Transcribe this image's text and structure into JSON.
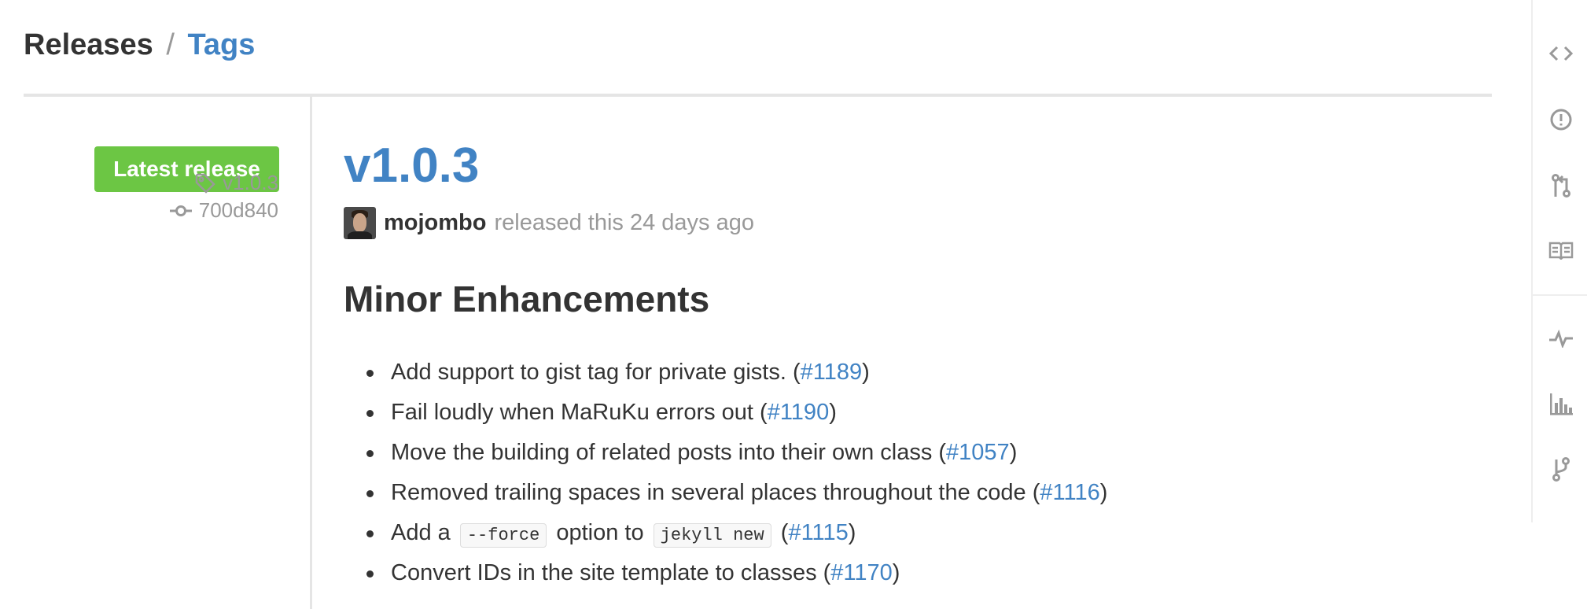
{
  "header": {
    "releases_label": "Releases",
    "separator": "/",
    "tags_label": "Tags"
  },
  "sidebar": {
    "latest_release_label": "Latest release",
    "tag_name": "v1.0.3",
    "commit_sha": "700d840",
    "latest_color": "#6cc644"
  },
  "release": {
    "version": "v1.0.3",
    "author": "mojombo",
    "released_text": "released this 24 days ago",
    "section_title": "Minor Enhancements",
    "notes": [
      {
        "before": "Add support to gist tag for private gists. (",
        "link": "#1189",
        "after": ")"
      },
      {
        "before": "Fail loudly when MaRuKu errors out (",
        "link": "#1190",
        "after": ")"
      },
      {
        "before": "Move the building of related posts into their own class (",
        "link": "#1057",
        "after": ")"
      },
      {
        "before": "Removed trailing spaces in several places throughout the code (",
        "link": "#1116",
        "after": ")"
      },
      {
        "before": "Add a",
        "code1": "--force",
        "middle": "option to",
        "code2": "jekyll new",
        "open_paren": "(",
        "link": "#1115",
        "after": ")"
      },
      {
        "before": "Convert IDs in the site template to classes (",
        "link": "#1170",
        "after": ")"
      }
    ]
  },
  "repo_nav": {
    "icons": [
      "code-icon",
      "issues-icon",
      "pull-request-icon",
      "wiki-icon",
      "pulse-icon",
      "graphs-icon",
      "network-icon"
    ]
  },
  "colors": {
    "link": "#4183c4",
    "muted": "#999999",
    "text": "#333333"
  }
}
